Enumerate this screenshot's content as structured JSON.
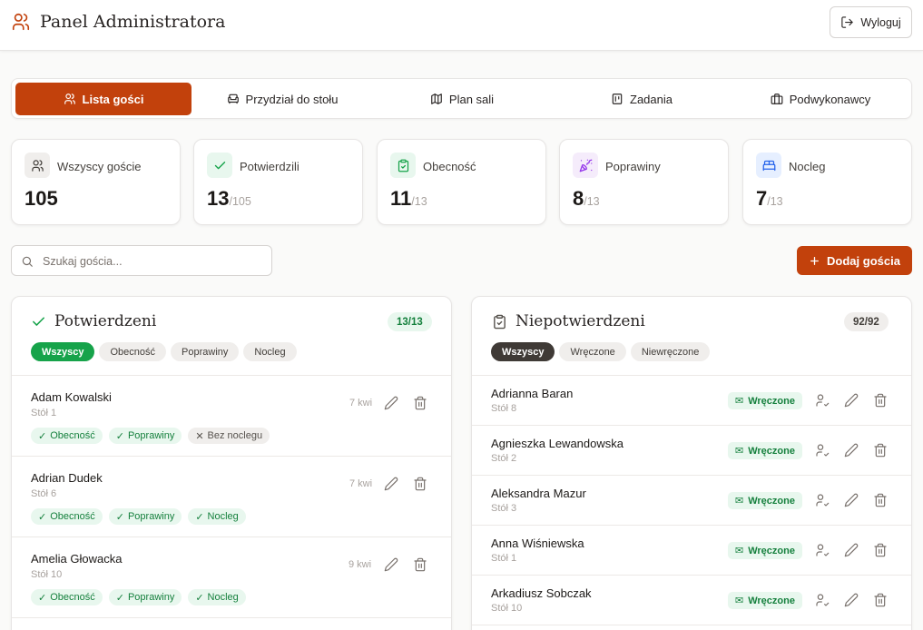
{
  "header": {
    "title": "Panel Administratora",
    "logout_label": "Wyloguj"
  },
  "tabs": [
    {
      "label": "Lista gości",
      "icon": "users-icon",
      "active": true
    },
    {
      "label": "Przydział do stołu",
      "icon": "armchair-icon"
    },
    {
      "label": "Plan sali",
      "icon": "map-icon"
    },
    {
      "label": "Zadania",
      "icon": "clipboard-icon"
    },
    {
      "label": "Podwykonawcy",
      "icon": "briefcase-icon"
    }
  ],
  "stats": [
    {
      "label": "Wszyscy goście",
      "value": "105",
      "total": "",
      "icon": "users-icon",
      "color": "#f0eeec"
    },
    {
      "label": "Potwierdzili",
      "value": "13",
      "total": "/105",
      "icon": "check-icon",
      "color": "#e8f7ee"
    },
    {
      "label": "Obecność",
      "value": "11",
      "total": "/13",
      "icon": "clipboard-check-icon",
      "color": "#e8f7ee"
    },
    {
      "label": "Poprawiny",
      "value": "8",
      "total": "/13",
      "icon": "party-popper-icon",
      "color": "#f5ecfb"
    },
    {
      "label": "Nocleg",
      "value": "7",
      "total": "/13",
      "icon": "bed-icon",
      "color": "#e6efff"
    }
  ],
  "search": {
    "placeholder": "Szukaj gościa..."
  },
  "add_button": {
    "label": "Dodaj gościa"
  },
  "confirmed": {
    "title": "Potwierdzeni",
    "count": "13/13",
    "filters": [
      "Wszyscy",
      "Obecność",
      "Poprawiny",
      "Nocleg"
    ],
    "guests": [
      {
        "name": "Adam Kowalski",
        "table": "Stół 1",
        "kwi": "7 kwi",
        "tags": [
          {
            "label": "Obecność",
            "ok": true
          },
          {
            "label": "Poprawiny",
            "ok": true
          },
          {
            "label": "Bez noclegu",
            "ok": false
          }
        ]
      },
      {
        "name": "Adrian Dudek",
        "table": "Stół 6",
        "kwi": "7 kwi",
        "tags": [
          {
            "label": "Obecność",
            "ok": true
          },
          {
            "label": "Poprawiny",
            "ok": true
          },
          {
            "label": "Nocleg",
            "ok": true
          }
        ]
      },
      {
        "name": "Amelia Głowacka",
        "table": "Stół 10",
        "kwi": "9 kwi",
        "tags": [
          {
            "label": "Obecność",
            "ok": true
          },
          {
            "label": "Poprawiny",
            "ok": true
          },
          {
            "label": "Nocleg",
            "ok": true
          }
        ]
      }
    ]
  },
  "unconfirmed": {
    "title": "Niepotwierdzeni",
    "count": "92/92",
    "filters": [
      "Wszyscy",
      "Wręczone",
      "Niewręczone"
    ],
    "guests": [
      {
        "name": "Adrianna Baran",
        "table": "Stół 8",
        "status": "Wręczone"
      },
      {
        "name": "Agnieszka Lewandowska",
        "table": "Stół 2",
        "status": "Wręczone"
      },
      {
        "name": "Aleksandra Mazur",
        "table": "Stół 3",
        "status": "Wręczone"
      },
      {
        "name": "Anna Wiśniewska",
        "table": "Stół 1",
        "status": "Wręczone"
      },
      {
        "name": "Arkadiusz Sobczak",
        "table": "Stół 10",
        "status": "Wręczone"
      }
    ]
  },
  "colors": {
    "accent": "#c2410c",
    "success": "#16a34a",
    "success_bg": "#e8f7ee"
  }
}
